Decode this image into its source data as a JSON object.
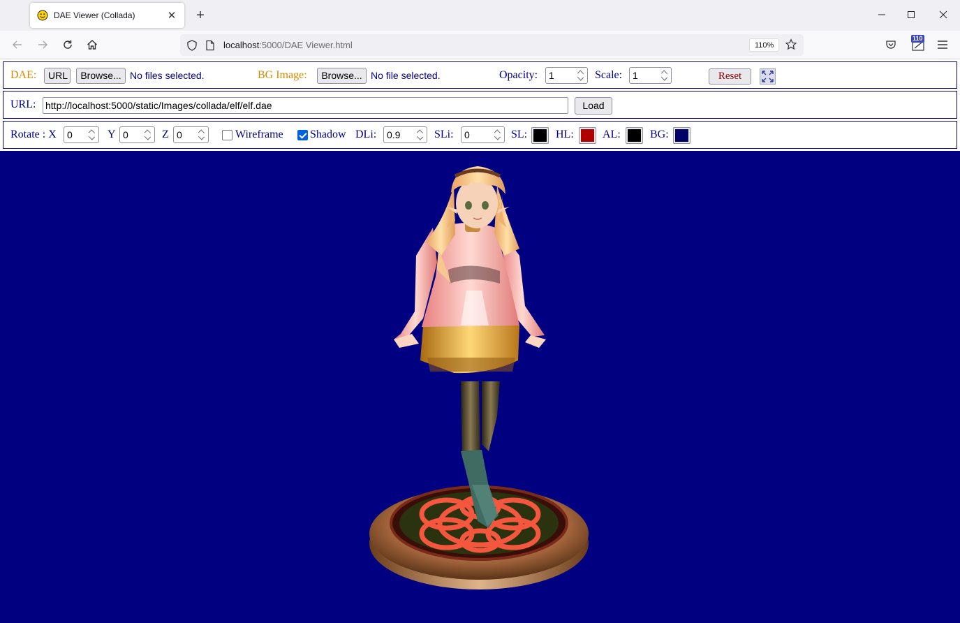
{
  "browser": {
    "tab_title": "DAE Viewer (Collada)",
    "url_host": "localhost",
    "url_rest": ":5000/DAE Viewer.html",
    "zoom": "110%",
    "extension_badge": "110"
  },
  "toolbar1": {
    "dae_label": "DAE:",
    "url_button": "URL",
    "browse_button": "Browse...",
    "dae_file_status": "No files selected.",
    "bg_image_label": "BG Image:",
    "bg_browse_button": "Browse...",
    "bg_file_status": "No file selected.",
    "opacity_label": "Opacity:",
    "opacity_value": "1",
    "scale_label": "Scale:",
    "scale_value": "1",
    "reset_button": "Reset"
  },
  "toolbar2": {
    "url_label": "URL:",
    "url_value": "http://localhost:5000/static/Images/collada/elf/elf.dae",
    "load_button": "Load"
  },
  "toolbar3": {
    "rotate_label": "Rotate : X",
    "x_value": "0",
    "y_label": "Y",
    "y_value": "0",
    "z_label": "Z",
    "z_value": "0",
    "wireframe_label": "Wireframe",
    "wireframe_checked": false,
    "shadow_label": "Shadow",
    "shadow_checked": true,
    "dli_label": "DLi:",
    "dli_value": "0.9",
    "sli_label": "SLi:",
    "sli_value": "0",
    "sl_label": "SL:",
    "sl_color": "#000000",
    "hl_label": "HL:",
    "hl_color": "#b00000",
    "al_label": "AL:",
    "al_color": "#000000",
    "bg_label": "BG:",
    "bg_color": "#000066"
  },
  "viewport": {
    "background": "#000080",
    "model": "elf-character-on-pedestal"
  }
}
